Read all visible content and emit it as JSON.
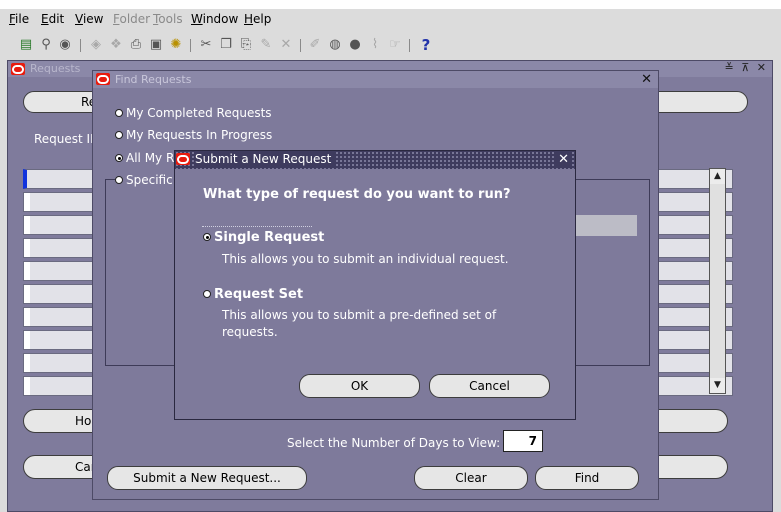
{
  "menubar": {
    "items": [
      {
        "label": "File",
        "ul": "F",
        "rest": "ile"
      },
      {
        "label": "Edit",
        "ul": "E",
        "rest": "dit"
      },
      {
        "label": "View",
        "ul": "V",
        "rest": "iew"
      },
      {
        "label": "Folder",
        "ul": "F",
        "rest": "older"
      },
      {
        "label": "Tools",
        "ul": "T",
        "rest": "ools"
      },
      {
        "label": "Window",
        "ul": "W",
        "rest": "indow"
      },
      {
        "label": "Help",
        "ul": "H",
        "rest": "elp"
      }
    ]
  },
  "toolbar": {
    "icons": [
      "new-record-icon",
      "find-icon",
      "navigator-icon",
      "save-icon",
      "next-step-icon",
      "print-icon",
      "close-form-icon",
      "cut-icon",
      "copy-icon",
      "paste-icon",
      "new-icon",
      "delete-icon",
      "edit-field-icon",
      "zoom-icon",
      "translations-icon",
      "attachments-icon",
      "folder-tools-icon",
      "help-icon"
    ],
    "help_glyph": "?"
  },
  "requests_window": {
    "title": "Requests",
    "refresh_button_fragment": "Re",
    "column_header_fragment": "Request ID",
    "hold_button_fragment": "Ho",
    "cancel_button_fragment": "Car",
    "controls": "≚ ⊼ ✕"
  },
  "find_window": {
    "title": "Find Requests",
    "close": "✕",
    "radios": [
      {
        "label": "My Completed Requests",
        "selected": false
      },
      {
        "label": "My Requests In Progress",
        "selected": false
      },
      {
        "label": "All My Requests",
        "visible": "All My R",
        "selected": true
      },
      {
        "label": "Specific Requests",
        "visible": "Specific",
        "selected": false
      }
    ],
    "days_label": "Select the Number of Days to View:",
    "days_value": "7",
    "submit_button": "Submit a New Request...",
    "clear_button": "Clear",
    "find_button": "Find"
  },
  "submit_dialog": {
    "title": "Submit a New Request",
    "close": "✕",
    "question": "What type of request do you want to run?",
    "options": [
      {
        "label": "Single Request",
        "description": "This allows you to submit an individual request.",
        "selected": true
      },
      {
        "label": "Request Set",
        "description": "This allows you to submit a pre-defined set of requests.",
        "selected": false
      }
    ],
    "ok_button": "OK",
    "cancel_button": "Cancel"
  },
  "colors": {
    "window_body": "#7e7a9b",
    "title_bar_active": "#3e3b5e",
    "oracle_red": "#e81b0e",
    "chrome_gray": "#dcdcdc"
  }
}
